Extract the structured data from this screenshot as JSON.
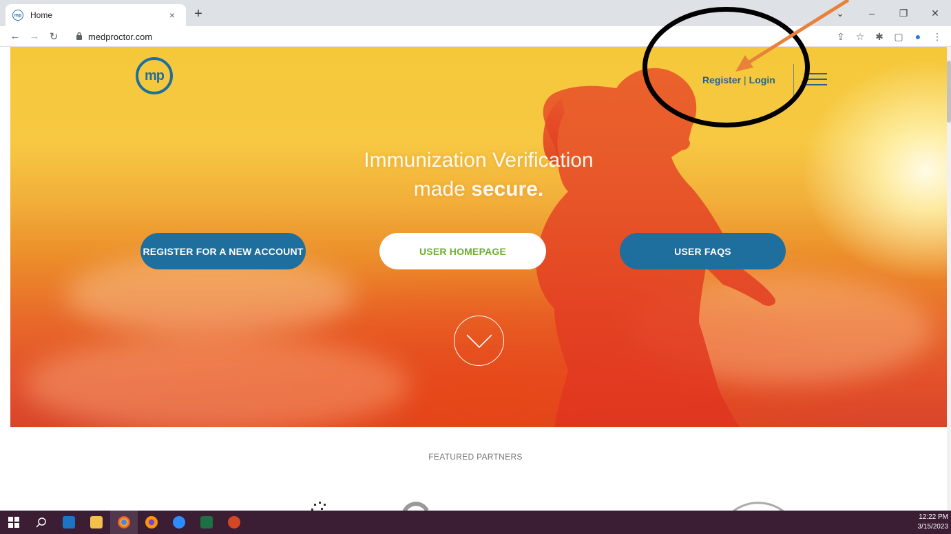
{
  "browser": {
    "tab_title": "Home",
    "tab_close": "×",
    "new_tab": "+",
    "url": "medproctor.com",
    "window_controls": [
      "⌄",
      "–",
      "❐",
      "✕"
    ]
  },
  "site": {
    "logo_text": "mp",
    "register_label": "Register",
    "login_label": "Login",
    "auth_separator": "|",
    "headline_line1": "Immunization Verification",
    "headline_line2_plain": "made ",
    "headline_line2_bold": "secure.",
    "buttons": {
      "register": "REGISTER FOR A NEW ACCOUNT",
      "homepage": "USER HOMEPAGE",
      "faqs": "USER FAQS"
    },
    "featured_partners": "FEATURED PARTNERS"
  },
  "taskbar": {
    "time": "12:22 PM",
    "date": "3/15/2023"
  },
  "colors": {
    "brand_blue": "#1e6e9e",
    "link_blue": "#2a5f8e",
    "green_text": "#6aae2e",
    "annotation_arrow": "#e8823a",
    "annotation_ellipse": "#000000"
  }
}
